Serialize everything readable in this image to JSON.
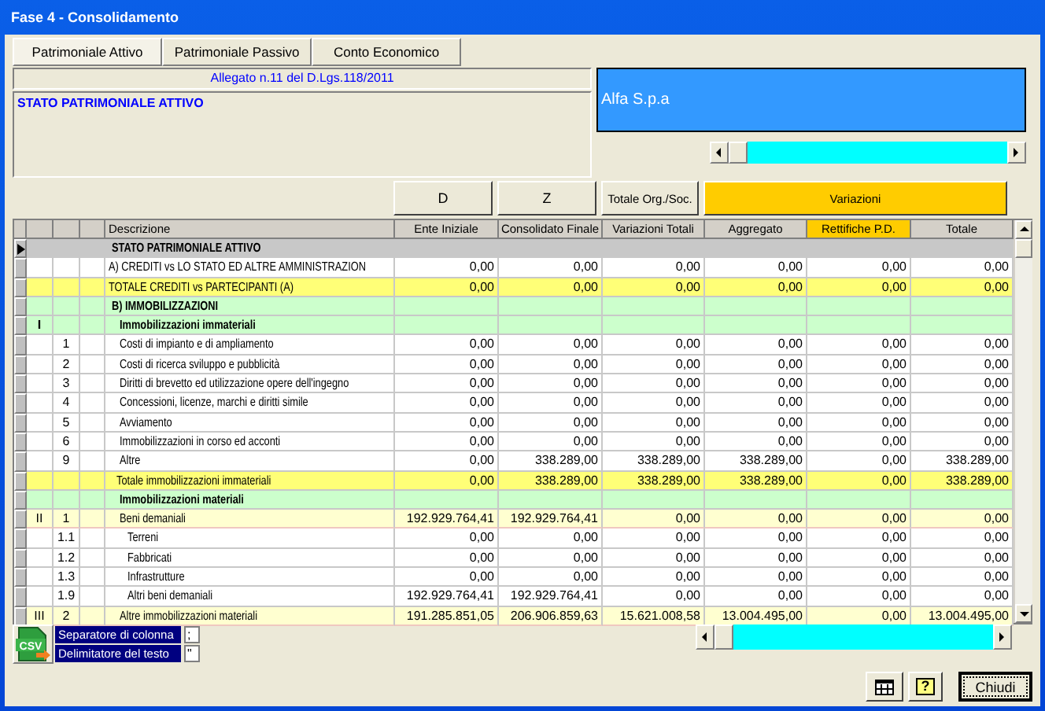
{
  "window": {
    "title": "Fase 4 - Consolidamento"
  },
  "tabs": [
    {
      "label": "Patrimoniale Attivo",
      "selected": true
    },
    {
      "label": "Patrimoniale Passivo",
      "selected": false
    },
    {
      "label": "Conto Economico",
      "selected": false
    }
  ],
  "header": {
    "reference": "Allegato n.11 del D.Lgs.118/2011",
    "section_title": "STATO PATRIMONIALE ATTIVO",
    "company": "Alfa S.p.a"
  },
  "column_groups": [
    {
      "label": "D",
      "color": "#ece9d8"
    },
    {
      "label": "Z",
      "color": "#ece9d8"
    },
    {
      "label": "Totale Org./Soc.",
      "color": "#ece9d8"
    },
    {
      "label": "Variazioni",
      "color": "#ffcc00"
    }
  ],
  "table": {
    "columns": [
      {
        "label": "Descrizione",
        "color": "#d4d0c8"
      },
      {
        "label": "Ente Iniziale",
        "color": "#d4d0c8"
      },
      {
        "label": "Consolidato Finale",
        "color": "#d4d0c8"
      },
      {
        "label": "Variazioni Totali",
        "color": "#d4d0c8"
      },
      {
        "label": "Aggregato",
        "color": "#d4d0c8"
      },
      {
        "label": "Rettifiche P.D.",
        "color": "#ffcc00"
      },
      {
        "label": "Totale",
        "color": "#d4d0c8"
      }
    ],
    "rows": [
      {
        "kind": "section",
        "selected": true,
        "description": "STATO PATRIMONIALE ATTIVO"
      },
      {
        "kind": "line",
        "selected": false,
        "description": "A) CREDITI vs LO STATO ED ALTRE AMMINISTRAZION",
        "values": [
          "0,00",
          "0,00",
          "0,00",
          "0,00",
          "0,00",
          "0,00"
        ]
      },
      {
        "kind": "total",
        "selected": false,
        "description": "TOTALE CREDITI vs PARTECIPANTI (A)",
        "values": [
          "0,00",
          "0,00",
          "0,00",
          "0,00",
          "0,00",
          "0,00"
        ]
      },
      {
        "kind": "group",
        "selected": false,
        "description": "B) IMMOBILIZZAZIONI"
      },
      {
        "kind": "subgroup",
        "selected": false,
        "level": "I",
        "description": "Immobilizzazioni immateriali"
      },
      {
        "kind": "item",
        "selected": false,
        "code": "1",
        "description": "Costi di impianto e di ampliamento",
        "values": [
          "0,00",
          "0,00",
          "0,00",
          "0,00",
          "0,00",
          "0,00"
        ]
      },
      {
        "kind": "item",
        "selected": false,
        "code": "2",
        "description": "Costi di ricerca sviluppo e pubblicità",
        "values": [
          "0,00",
          "0,00",
          "0,00",
          "0,00",
          "0,00",
          "0,00"
        ]
      },
      {
        "kind": "item",
        "selected": false,
        "code": "3",
        "description": "Diritti di brevetto ed utilizzazione opere dell'ingegno",
        "values": [
          "0,00",
          "0,00",
          "0,00",
          "0,00",
          "0,00",
          "0,00"
        ]
      },
      {
        "kind": "item",
        "selected": false,
        "code": "4",
        "description": "Concessioni, licenze, marchi e diritti simile",
        "values": [
          "0,00",
          "0,00",
          "0,00",
          "0,00",
          "0,00",
          "0,00"
        ]
      },
      {
        "kind": "item",
        "selected": false,
        "code": "5",
        "description": "Avviamento",
        "values": [
          "0,00",
          "0,00",
          "0,00",
          "0,00",
          "0,00",
          "0,00"
        ]
      },
      {
        "kind": "item",
        "selected": false,
        "code": "6",
        "description": "Immobilizzazioni in corso ed acconti",
        "values": [
          "0,00",
          "0,00",
          "0,00",
          "0,00",
          "0,00",
          "0,00"
        ]
      },
      {
        "kind": "item",
        "selected": false,
        "code": "9",
        "description": "Altre",
        "values": [
          "0,00",
          "338.289,00",
          "338.289,00",
          "338.289,00",
          "0,00",
          "338.289,00"
        ]
      },
      {
        "kind": "subtotal",
        "selected": false,
        "description": "Totale immobilizzazioni immateriali",
        "values": [
          "0,00",
          "338.289,00",
          "338.289,00",
          "338.289,00",
          "0,00",
          "338.289,00"
        ]
      },
      {
        "kind": "subgroup",
        "selected": false,
        "description": "Immobilizzazioni materiali"
      },
      {
        "kind": "main-item",
        "selected": false,
        "level": "II",
        "code": "1",
        "description": "Beni demaniali",
        "values": [
          "192.929.764,41",
          "192.929.764,41",
          "0,00",
          "0,00",
          "0,00",
          "0,00"
        ]
      },
      {
        "kind": "subitem",
        "selected": false,
        "code": "1.1",
        "description": "Terreni",
        "values": [
          "0,00",
          "0,00",
          "0,00",
          "0,00",
          "0,00",
          "0,00"
        ]
      },
      {
        "kind": "subitem",
        "selected": false,
        "code": "1.2",
        "description": "Fabbricati",
        "values": [
          "0,00",
          "0,00",
          "0,00",
          "0,00",
          "0,00",
          "0,00"
        ]
      },
      {
        "kind": "subitem",
        "selected": false,
        "code": "1.3",
        "description": "Infrastrutture",
        "values": [
          "0,00",
          "0,00",
          "0,00",
          "0,00",
          "0,00",
          "0,00"
        ]
      },
      {
        "kind": "subitem",
        "selected": false,
        "code": "1.9",
        "description": "Altri beni demaniali",
        "values": [
          "192.929.764,41",
          "192.929.764,41",
          "0,00",
          "0,00",
          "0,00",
          "0,00"
        ]
      },
      {
        "kind": "main-item",
        "selected": false,
        "level": "III",
        "code": "2",
        "description": "Altre immobilizzazioni materiali",
        "values": [
          "191.285.851,05",
          "206.906.859,63",
          "15.621.008,58",
          "13.004.495,00",
          "0,00",
          "13.004.495,00"
        ]
      }
    ]
  },
  "export": {
    "icon_text": "CSV",
    "column_separator_label": "Separatore di colonna",
    "column_separator": ";",
    "text_delimiter_label": "Delimitatore del testo",
    "text_delimiter": "\""
  },
  "buttons": {
    "help": "?",
    "close": "Chiudi"
  }
}
